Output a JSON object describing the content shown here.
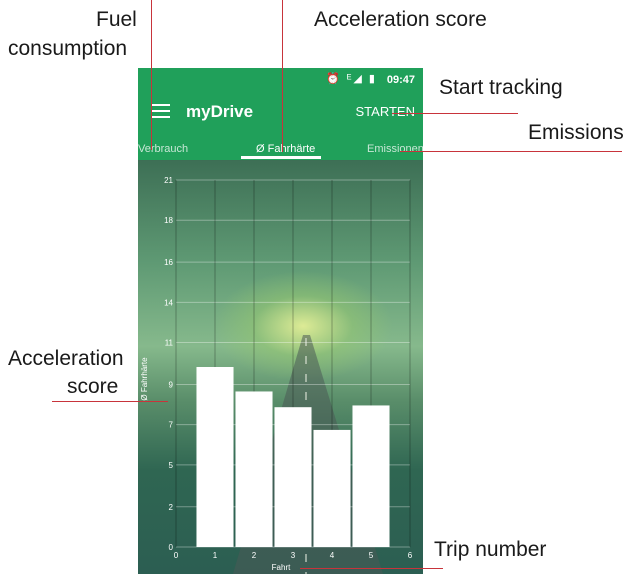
{
  "annotations": {
    "fuel_line1": "Fuel",
    "fuel_line2": "consumption",
    "acceleration_top": "Acceleration score",
    "start_tracking": "Start tracking",
    "emissions": "Emissions",
    "acceleration_left_line1": "Acceleration",
    "acceleration_left_line2": "score",
    "trip_number": "Trip number"
  },
  "status_bar": {
    "time": "09:47",
    "icons": "⏰ ᴱ◢ ▮"
  },
  "app_bar": {
    "title": "myDrive",
    "start_label": "STARTEN",
    "menu_icon": "hamburger-menu-icon"
  },
  "tabs": [
    {
      "label": "Verbrauch",
      "selected": false
    },
    {
      "label": "Ø Fahrhärte",
      "selected": true
    },
    {
      "label": "Emissionen",
      "selected": false
    }
  ],
  "colors": {
    "app_bar": "#20a05a",
    "annotation_line": "#c8343b",
    "bar": "#ffffff"
  },
  "chart_data": {
    "type": "bar",
    "categories": [
      "1",
      "2",
      "3",
      "4",
      "5"
    ],
    "values": [
      10.3,
      8.9,
      8.0,
      6.7,
      8.1
    ],
    "x_ticks": [
      "0",
      "1",
      "2",
      "3",
      "4",
      "5",
      "6"
    ],
    "xlim": [
      0,
      6
    ],
    "y_ticks": [
      "0",
      "2",
      "5",
      "7",
      "9",
      "11",
      "14",
      "16",
      "18",
      "21"
    ],
    "y_tick_values": [
      0,
      2.3,
      4.7,
      7,
      9.3,
      11.7,
      14,
      16.3,
      18.7,
      21
    ],
    "ylim": [
      0,
      21
    ],
    "xlabel": "Fahrt",
    "ylabel": "Ø Fahrhärte",
    "grid": true
  }
}
